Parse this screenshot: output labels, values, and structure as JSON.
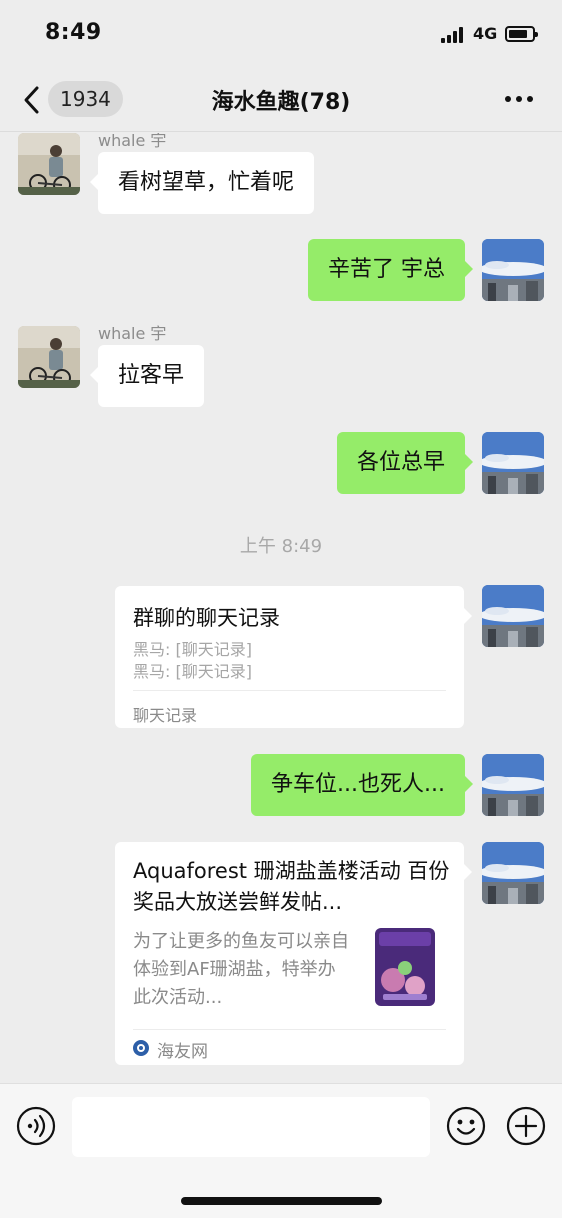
{
  "status": {
    "time": "8:49",
    "network": "4G"
  },
  "nav": {
    "back_count": "1934",
    "title": "海水鱼趣(78)"
  },
  "messages": {
    "m1": {
      "sender": "whale 宇",
      "text": "看树望草，忙着呢"
    },
    "m2": {
      "text": "辛苦了 宇总"
    },
    "m3": {
      "sender": "whale 宇",
      "text": "拉客早"
    },
    "m4": {
      "text": "各位总早"
    },
    "timestamp": "上午 8:49",
    "record": {
      "title": "群聊的聊天记录",
      "lines": [
        "黑马: [聊天记录]",
        "黑马: [聊天记录]"
      ],
      "footer": "聊天记录"
    },
    "m5": {
      "text": "争车位...也死人..."
    },
    "link": {
      "title": "Aquaforest 珊湖盐盖楼活动 百份奖品大放送尝鲜发帖...",
      "description": "为了让更多的鱼友可以亲自体验到AF珊湖盐，特举办此次活动...",
      "source": "海友网"
    }
  },
  "input": {
    "placeholder": ""
  },
  "icons": {
    "back": "chevron-left-icon",
    "more": "more-dots-icon",
    "voice": "voice-icon",
    "emoji": "emoji-icon",
    "plus": "plus-icon"
  },
  "colors": {
    "own_bubble": "#95ec69",
    "background": "#ededed"
  }
}
